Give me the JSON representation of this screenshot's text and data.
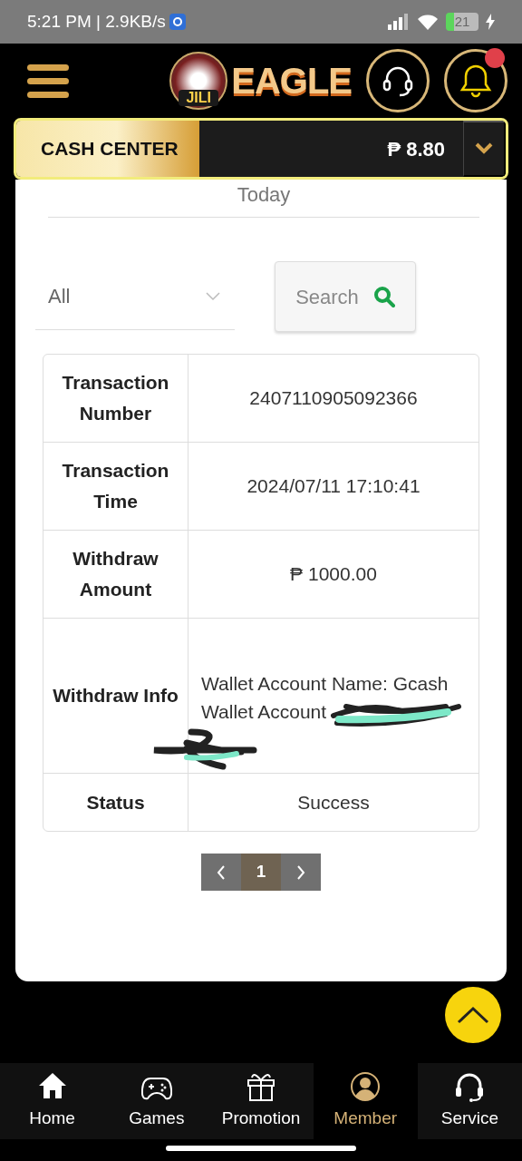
{
  "status_bar": {
    "time": "5:21 PM | 2.9KB/s",
    "battery": "21",
    "charging": true
  },
  "header": {
    "logo_text": "EAGLE",
    "logo_badge": "JILI",
    "has_notification": true
  },
  "cash_center": {
    "label": "CASH CENTER",
    "balance": "₱ 8.80"
  },
  "filters": {
    "date": "Today",
    "type": "All",
    "search_button": "Search"
  },
  "details": [
    {
      "label": "Transaction Number",
      "kind": "text",
      "value": "2407110905092366"
    },
    {
      "label": "Transaction Time",
      "kind": "text",
      "value": "2024/07/11 17:10:41"
    },
    {
      "label": "Withdraw Amount",
      "kind": "text",
      "value": "₱ 1000.00"
    },
    {
      "label": "Withdraw Info",
      "kind": "lines",
      "lines": [
        "Wallet Account Name: Gcash",
        "Wallet Account"
      ],
      "redacted": true
    },
    {
      "label": "Status",
      "kind": "text",
      "value": "Success"
    }
  ],
  "pagination": {
    "pages": [
      {
        "label": "1",
        "selected": true
      }
    ]
  },
  "bottom_nav": [
    {
      "label": "Home",
      "selected": false
    },
    {
      "label": "Games",
      "selected": false
    },
    {
      "label": "Promotion",
      "selected": false
    },
    {
      "label": "Member",
      "selected": true
    },
    {
      "label": "Service",
      "selected": false
    }
  ]
}
